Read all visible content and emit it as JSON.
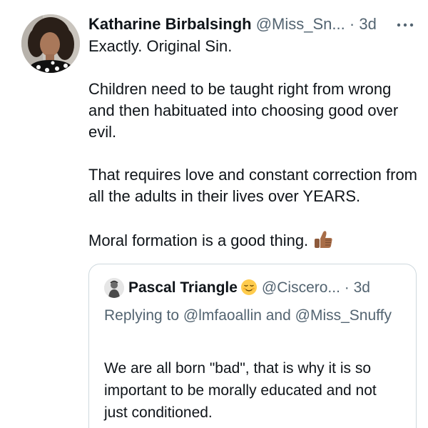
{
  "tweet": {
    "author_name": "Katharine Birbalsingh",
    "author_handle": "@Miss_Sn...",
    "dot": "·",
    "time": "3d",
    "avatar_icon": "person-photo-avatar",
    "more_icon": "more-dots-icon",
    "lines": [
      "Exactly. Original Sin.",
      "Children need to be taught right from wrong and then habituated into choosing good over evil.",
      "That requires love and constant correction from all the adults in their lives over YEARS.",
      "Moral formation is a good thing."
    ],
    "emoji": "thumbs-up-icon"
  },
  "quote": {
    "author_name": "Pascal Triangle",
    "emoji": "relieved-face-icon",
    "author_handle": "@Ciscero...",
    "dot": "·",
    "time": "3d",
    "replying_to": "Replying to @lmfaoallin and @Miss_Snuffy",
    "text": "We are all born \"bad\", that is why it is so important to be morally educated and not just conditioned."
  },
  "colors": {
    "text": "#0f1419",
    "secondary": "#536471",
    "border": "#cfd9de"
  }
}
